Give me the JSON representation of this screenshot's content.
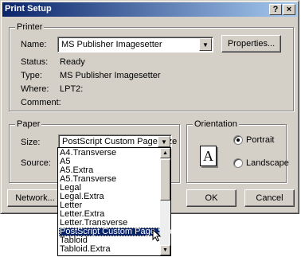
{
  "window": {
    "title": "Print Setup",
    "help_label": "?",
    "close_label": "×"
  },
  "printer": {
    "group_label": "Printer",
    "name_label": "Name:",
    "name_value": "MS Publisher Imagesetter",
    "properties_label": "Properties...",
    "status_label": "Status:",
    "status_value": "Ready",
    "type_label": "Type:",
    "type_value": "MS Publisher Imagesetter",
    "where_label": "Where:",
    "where_value": "LPT2:",
    "comment_label": "Comment:"
  },
  "paper": {
    "group_label": "Paper",
    "size_label": "Size:",
    "size_value": "PostScript Custom Page Size",
    "source_label": "Source:",
    "size_options": [
      "A4.Transverse",
      "A5",
      "A5.Extra",
      "A5.Transverse",
      "Legal",
      "Legal.Extra",
      "Letter",
      "Letter.Extra",
      "Letter.Transverse",
      "PostScript Custom Page Size",
      "Tabloid",
      "Tabloid.Extra"
    ],
    "selected_option": "PostScript Custom Page Size"
  },
  "orientation": {
    "group_label": "Orientation",
    "portrait_label": "Portrait",
    "landscape_label": "Landscape",
    "selected": "Portrait",
    "page_icon_letter": "A"
  },
  "buttons": {
    "network_label": "Network...",
    "ok_label": "OK",
    "cancel_label": "Cancel"
  },
  "icons": {
    "dropdown_arrow": "▼",
    "scroll_up": "▲",
    "scroll_down": "▼"
  }
}
